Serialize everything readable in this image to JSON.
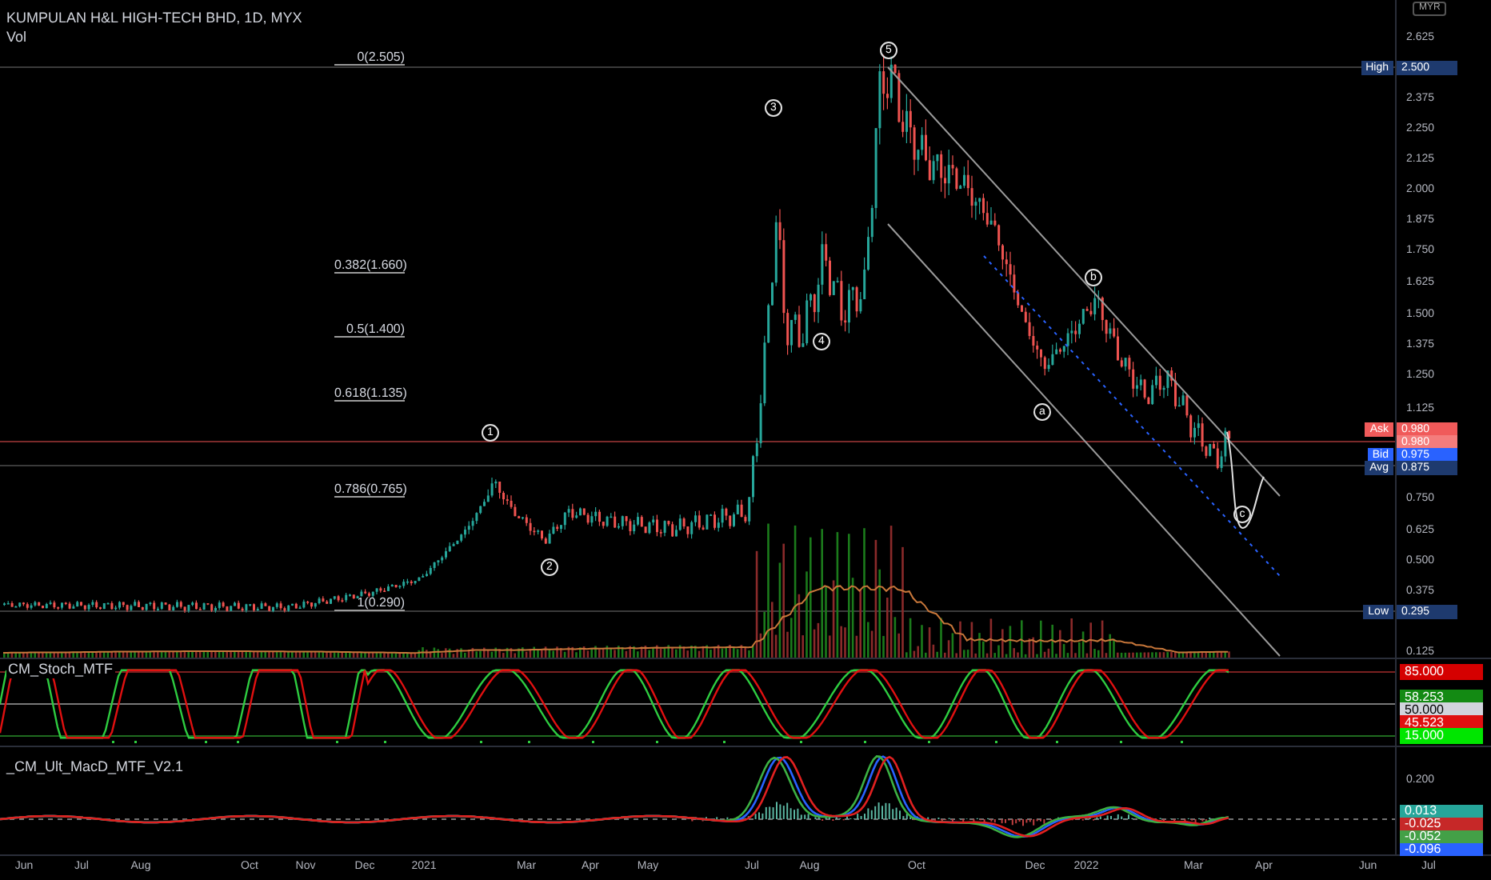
{
  "header": {
    "symbol": "KUMPULAN H&L HIGH-TECH BHD, 1D, MYX",
    "volume_label": "Vol"
  },
  "fib_levels": [
    "0(2.505)",
    "0.382(1.660)",
    "0.5(1.400)",
    "0.618(1.135)",
    "0.786(0.765)",
    "1(0.290)"
  ],
  "wave_labels": [
    "1",
    "2",
    "3",
    "4",
    "5",
    "a",
    "b",
    "c"
  ],
  "price_axis": {
    "currency": "MYR",
    "ticks": [
      "2.625",
      "2.375",
      "2.250",
      "2.125",
      "2.000",
      "1.875",
      "1.750",
      "1.625",
      "1.500",
      "1.375",
      "1.250",
      "1.125",
      "0.750",
      "0.625",
      "0.500",
      "0.375",
      "0.125"
    ],
    "markers": [
      {
        "kind": "high",
        "tag": "High",
        "value": "2.500"
      },
      {
        "kind": "ask",
        "tag": "Ask",
        "value": "0.980"
      },
      {
        "kind": "last",
        "value": "0.980"
      },
      {
        "kind": "bid",
        "tag": "Bid",
        "value": "0.975"
      },
      {
        "kind": "avg",
        "tag": "Avg",
        "value": "0.875"
      },
      {
        "kind": "low",
        "tag": "Low",
        "value": "0.295"
      }
    ]
  },
  "stoch": {
    "title": "CM_Stoch_MTF",
    "readings": [
      {
        "value": "85.000",
        "color": "#d50000"
      },
      {
        "value": "58.253",
        "color": "#138a13"
      },
      {
        "value": "50.000",
        "color": "#d1d4dc"
      },
      {
        "value": "45.523",
        "color": "#e01010"
      },
      {
        "value": "15.000",
        "color": "#00e600"
      }
    ]
  },
  "macd": {
    "title": "_CM_Ult_MacD_MTF_V2.1",
    "tick": "0.200",
    "readings": [
      {
        "value": "0.013",
        "color": "#26a69a"
      },
      {
        "value": "-0.025",
        "color": "#c62828"
      },
      {
        "value": "-0.052",
        "color": "#43a047"
      },
      {
        "value": "-0.096",
        "color": "#2962ff"
      }
    ]
  },
  "time_axis": [
    "Jun",
    "Jul",
    "Aug",
    "Oct",
    "Nov",
    "Dec",
    "2021",
    "Mar",
    "Apr",
    "May",
    "Jul",
    "Aug",
    "Oct",
    "Dec",
    "2022",
    "Mar",
    "Apr",
    "Jun",
    "Jul"
  ]
}
